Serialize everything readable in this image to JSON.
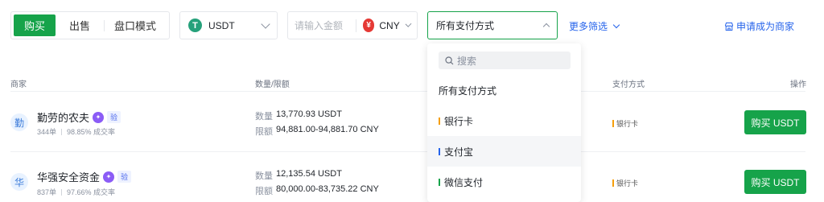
{
  "filters": {
    "modes": [
      {
        "label": "购买",
        "active": true
      },
      {
        "label": "出售",
        "active": false
      },
      {
        "label": "盘口模式",
        "active": false
      }
    ],
    "coin": {
      "icon": "tether-icon",
      "label": "USDT"
    },
    "amount": {
      "placeholder": "请输入金额",
      "currency_icon": "yuan-icon",
      "currency": "CNY"
    },
    "payment": {
      "label": "所有支付方式",
      "expanded": true
    },
    "more_label": "更多筛选",
    "become_merchant_label": "申请成为商家"
  },
  "table": {
    "headers": {
      "merchant": "商家",
      "quantity_limit": "数量/限额",
      "payment": "支付方式",
      "action": "操作"
    },
    "rows": [
      {
        "avatar": "勤",
        "name": "勤劳的农夫",
        "badge_tag": "验",
        "orders": "344单",
        "completion": "98.85% 成交率",
        "qty_key": "数量",
        "qty": "13,770.93 USDT",
        "limit_key": "限额",
        "limit": "94,881.00-94,881.70 CNY",
        "payment": "银行卡",
        "payment_color": "#f59e0b",
        "buy_label": "购买 USDT"
      },
      {
        "avatar": "华",
        "name": "华强安全资金",
        "badge_tag": "验",
        "orders": "837单",
        "completion": "97.66% 成交率",
        "qty_key": "数量",
        "qty": "12,135.54 USDT",
        "limit_key": "限额",
        "limit": "80,000.00-83,735.22 CNY",
        "payment": "银行卡",
        "payment_color": "#f59e0b",
        "buy_label": "购买 USDT"
      }
    ]
  },
  "dropdown": {
    "search_placeholder": "搜索",
    "options": [
      {
        "label": "所有支付方式",
        "color": ""
      },
      {
        "label": "银行卡",
        "color": "#f59e0b"
      },
      {
        "label": "支付宝",
        "color": "#2563eb"
      },
      {
        "label": "微信支付",
        "color": "#16a34a"
      }
    ]
  }
}
